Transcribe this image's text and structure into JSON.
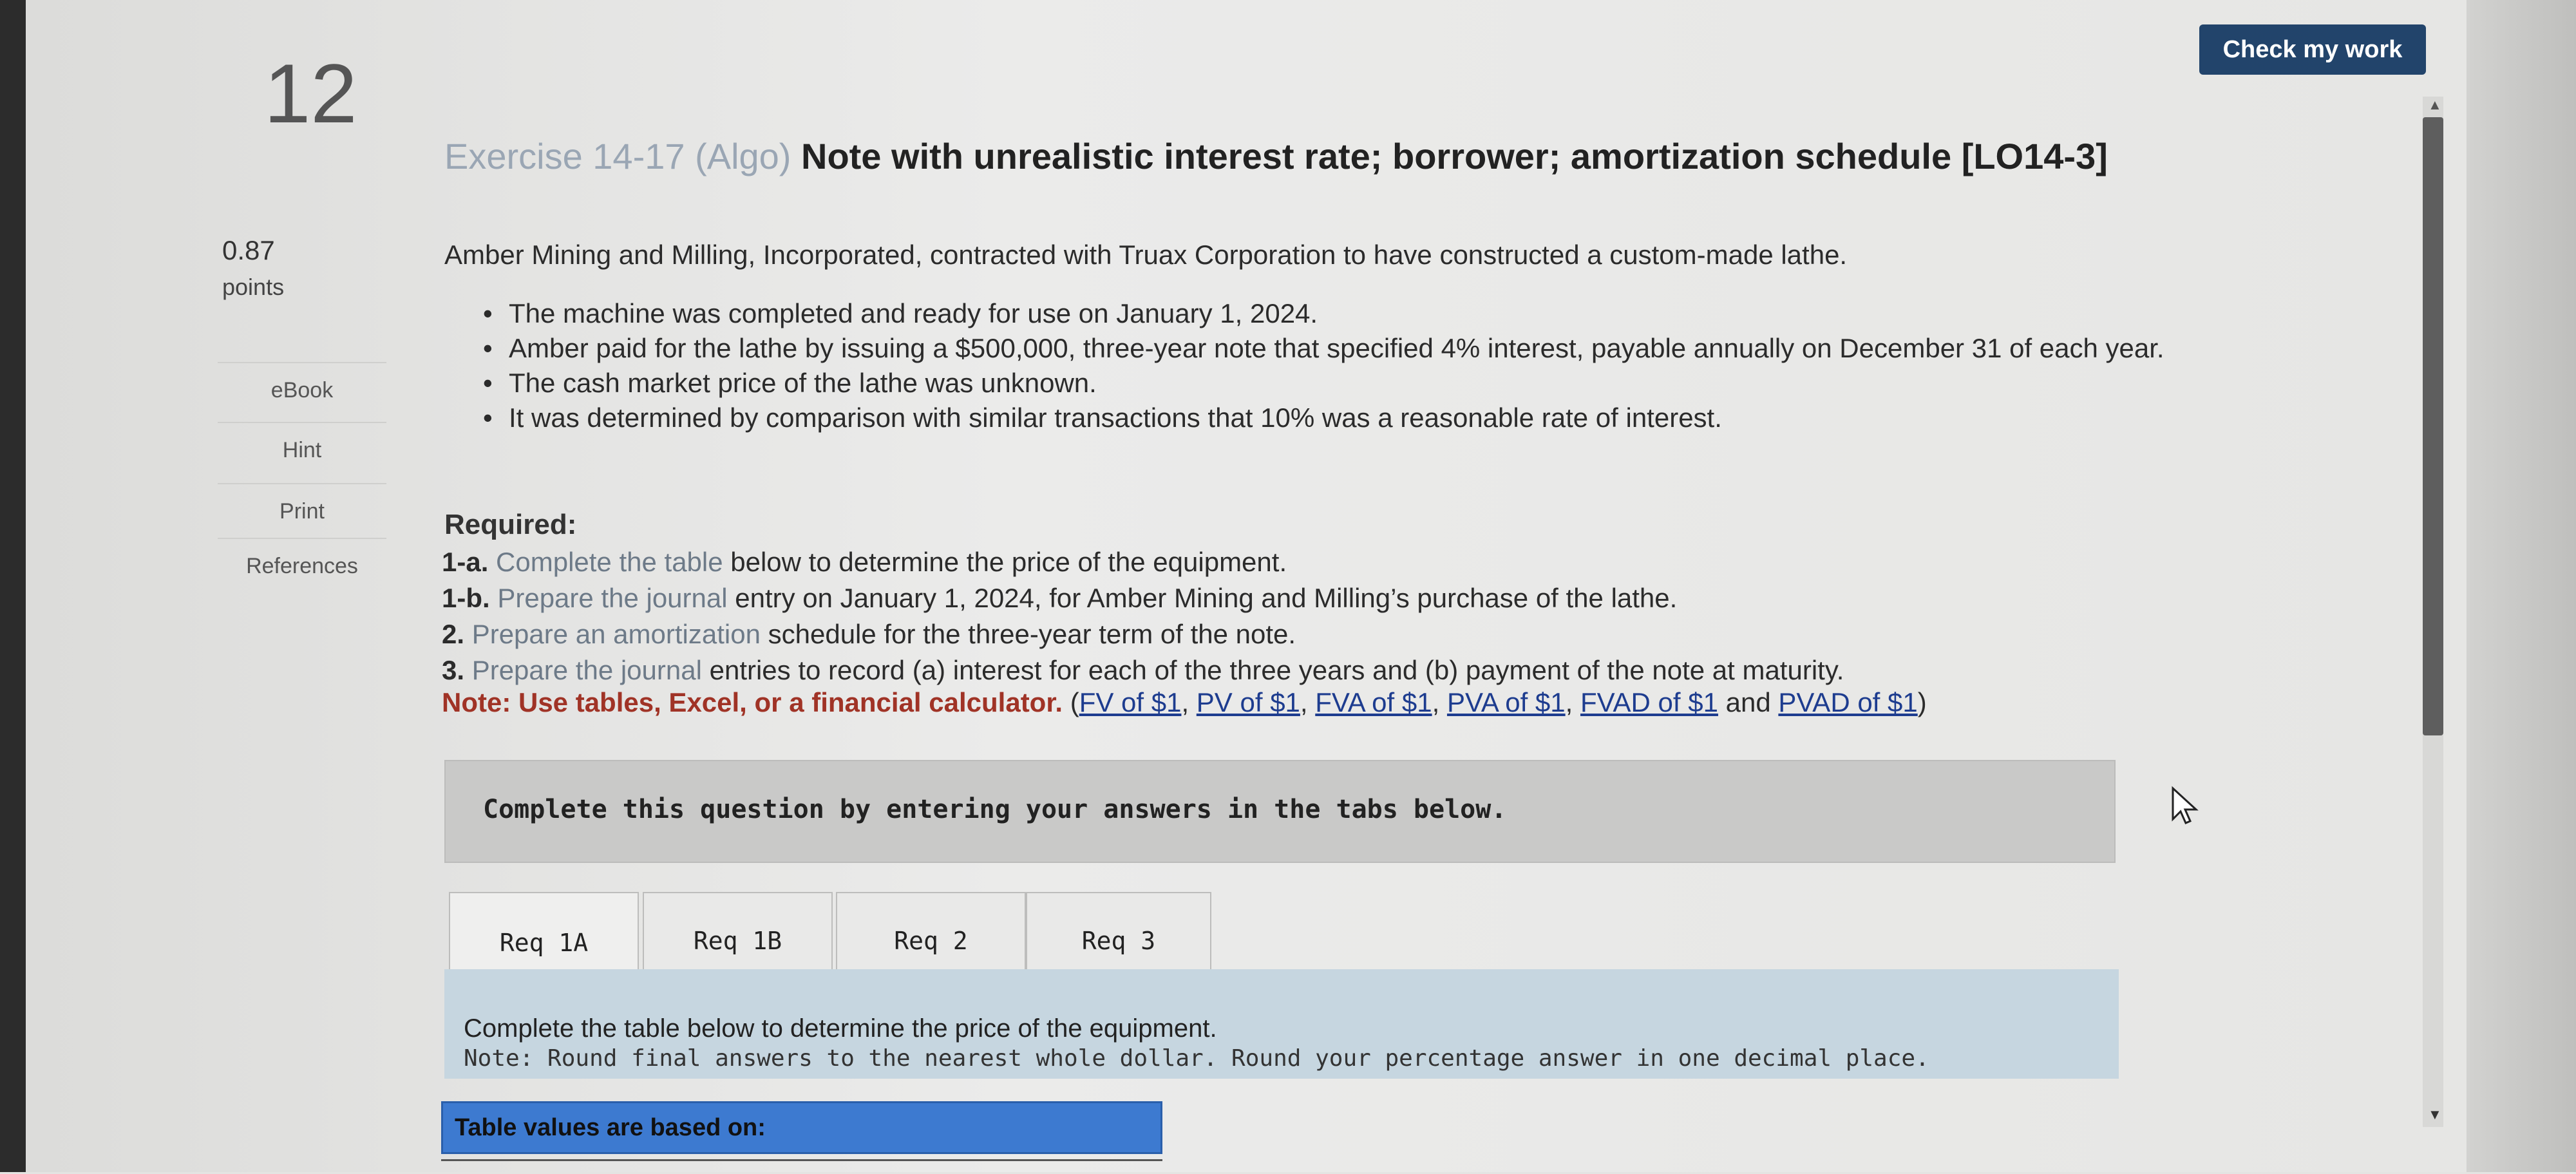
{
  "question": {
    "number": "12",
    "points_value": "0.87",
    "points_label": "points"
  },
  "sidebar": {
    "items": [
      {
        "label": "eBook"
      },
      {
        "label": "Hint"
      },
      {
        "label": "Print"
      },
      {
        "label": "References"
      }
    ]
  },
  "header": {
    "check_button": "Check my work"
  },
  "exercise": {
    "title_prefix": "Exercise 14-17 (Algo)",
    "title_rest": " Note with unrealistic interest rate; borrower; amortization schedule [LO14-3]",
    "intro": "Amber Mining and Milling, Incorporated, contracted with Truax Corporation to have constructed a custom-made lathe.",
    "bullets": [
      "The machine was completed and ready for use on January 1, 2024.",
      "Amber paid for the lathe by issuing a $500,000, three-year note that specified 4% interest, payable annually on December 31 of each year.",
      "The cash market price of the lathe was unknown.",
      "It was determined by comparison with similar transactions that 10% was a reasonable rate of interest."
    ],
    "required_label": "Required:",
    "requirements": [
      {
        "tag": "1-a.",
        "lead": " Complete the table",
        "rest": " below to determine the price of the equipment."
      },
      {
        "tag": "1-b.",
        "lead": " Prepare the journal",
        "rest": " entry on January 1, 2024, for Amber Mining and Milling’s purchase of the lathe."
      },
      {
        "tag": "2.",
        "lead": " Prepare an amortization",
        "rest": " schedule for the three-year term of the note."
      },
      {
        "tag": "3.",
        "lead": " Prepare the journal",
        "rest": " entries to record (a) interest for each of the three years and (b) payment of the note at maturity."
      }
    ],
    "note_label": "Note: Use tables, Excel, or a financial calculator.",
    "note_links": [
      "FV of $1",
      "PV of $1",
      "FVA of $1",
      "PVA of $1",
      "FVAD of $1",
      "PVAD of $1"
    ],
    "note_and": " and "
  },
  "instructions": "Complete this question by entering your answers in the tabs below.",
  "tabs": [
    {
      "label": "Req 1A"
    },
    {
      "label": "Req 1B"
    },
    {
      "label": "Req 2"
    },
    {
      "label": "Req 3"
    }
  ],
  "panel": {
    "line1": "Complete the table below to determine the price of the equipment.",
    "line2": "Note: Round final answers to the nearest whole dollar. Round your percentage answer in one decimal place."
  },
  "table": {
    "header": "Table values are based on:"
  },
  "colors": {
    "check_button_bg": "#22446b",
    "note_red": "#a03326",
    "link_blue": "#1d3c8f",
    "table_header_blue": "#3d7ad0",
    "panel_blue": "#c6d6e0"
  }
}
